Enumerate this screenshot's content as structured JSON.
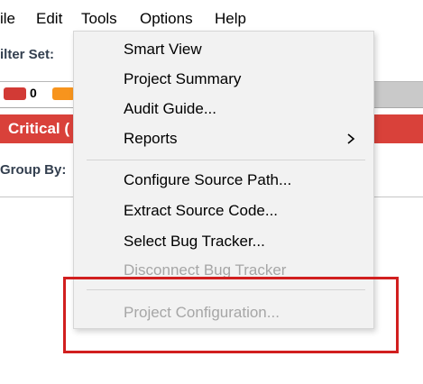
{
  "menubar": {
    "items": [
      {
        "label": "ile"
      },
      {
        "label": "Edit"
      },
      {
        "label": "Tools"
      },
      {
        "label": "Options"
      },
      {
        "label": "Help"
      }
    ]
  },
  "background": {
    "filter_set_label": "ilter Set:",
    "counts": [
      {
        "value": "0",
        "color": "#d23a35"
      },
      {
        "value": "",
        "color": "#f7941d"
      }
    ],
    "critical_label": "Critical (",
    "group_by_label": "Group By:"
  },
  "tools_menu": {
    "items": [
      {
        "label": "Smart View",
        "enabled": true
      },
      {
        "label": "Project Summary",
        "enabled": true
      },
      {
        "label": "Audit Guide...",
        "enabled": true
      },
      {
        "label": "Reports",
        "enabled": true,
        "submenu": true
      },
      {
        "label": "Configure Source Path...",
        "enabled": true
      },
      {
        "label": "Extract Source Code...",
        "enabled": true
      },
      {
        "label": "Select Bug Tracker...",
        "enabled": true
      },
      {
        "label": "Disconnect Bug Tracker",
        "enabled": false
      },
      {
        "label": "Project Configuration...",
        "enabled": false
      }
    ]
  },
  "annotation": {
    "highlight_color": "#d11f1f"
  }
}
